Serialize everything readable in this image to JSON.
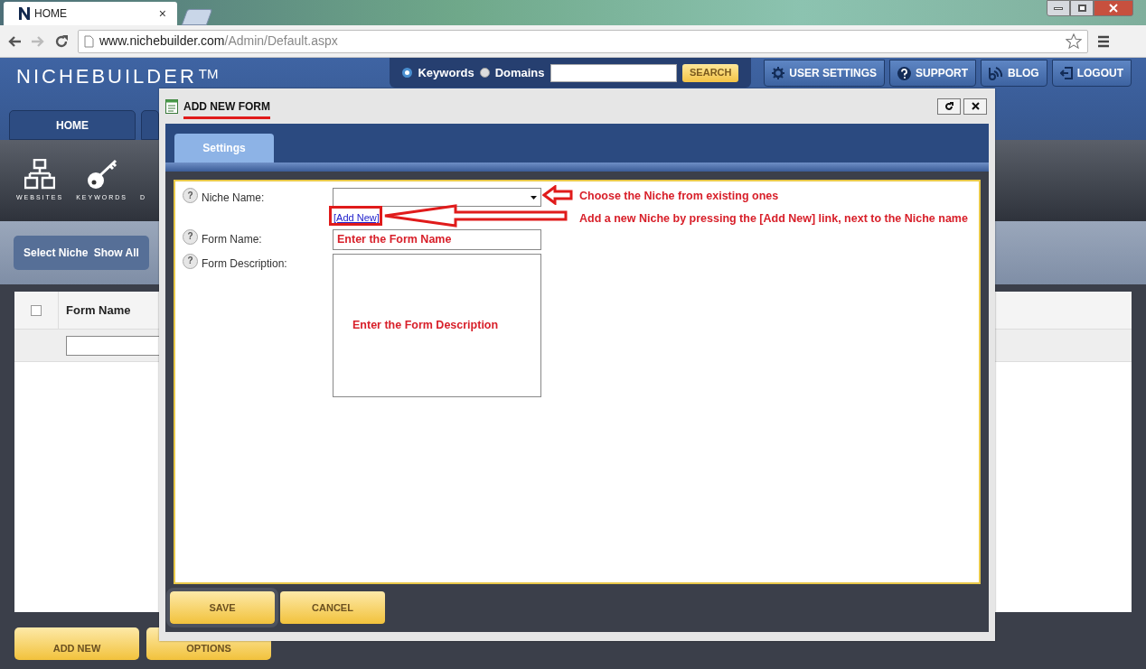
{
  "browser": {
    "tab_title": "HOME",
    "tab_close": "×",
    "url_host": "www.nichebuilder.com",
    "url_path": "/Admin/Default.aspx"
  },
  "header": {
    "logo": "NICHEBUILDER",
    "trademark": "TM",
    "search_options": [
      {
        "label": "Keywords",
        "selected": true
      },
      {
        "label": "Domains",
        "selected": false
      }
    ],
    "search_button": "SEARCH",
    "nav_buttons": [
      {
        "label": "USER SETTINGS",
        "kind": "gear"
      },
      {
        "label": "SUPPORT",
        "kind": "help"
      },
      {
        "label": "BLOG",
        "kind": "feed"
      },
      {
        "label": "LOGOUT",
        "kind": "exit"
      }
    ]
  },
  "main_tabs": [
    {
      "label": "HOME"
    }
  ],
  "toolbar": [
    {
      "label": "WEBSITES",
      "kind": "sitemap"
    },
    {
      "label": "KEYWORDS",
      "kind": "key"
    },
    {
      "label": "D",
      "kind": "none"
    }
  ],
  "filter_bar": [
    "Select Niche",
    "Show All"
  ],
  "table": {
    "select_all_checked": false,
    "columns": [
      "Form Name"
    ]
  },
  "footer_buttons": [
    "ADD NEW",
    "OPTIONS"
  ],
  "dialog": {
    "title": "ADD NEW FORM",
    "tabs": [
      {
        "label": "Settings",
        "selected": true
      }
    ],
    "fields": [
      {
        "label": "Niche Name:",
        "kind": "select",
        "link": "[Add New]",
        "help": "?"
      },
      {
        "label": "Form Name:",
        "kind": "text",
        "help": "?"
      },
      {
        "label": "Form Description:",
        "kind": "textarea",
        "help": "?"
      }
    ],
    "buttons": [
      {
        "label": "SAVE",
        "focused": true
      },
      {
        "label": "CANCEL",
        "focused": false
      }
    ]
  },
  "annotations": {
    "niche_select": "Choose the Niche from existing ones",
    "add_new": "Add a new Niche by pressing the [Add New] link, next to the Niche name",
    "form_name": "Enter the Form Name",
    "form_description": "Enter the Form Description"
  }
}
